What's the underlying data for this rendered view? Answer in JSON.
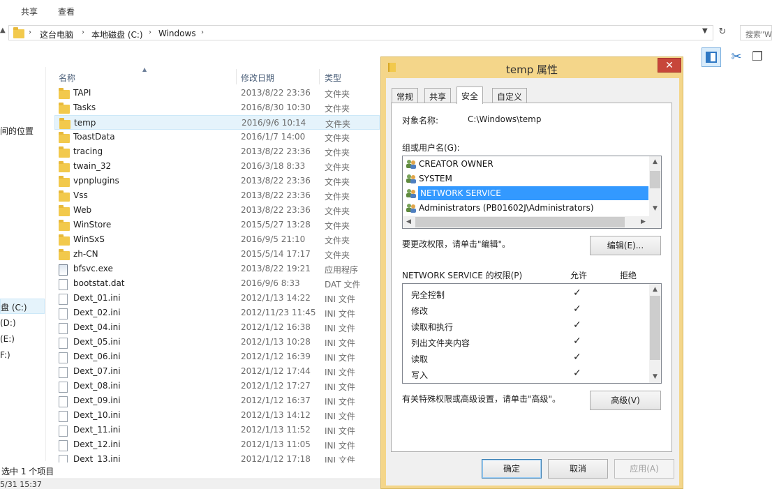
{
  "ribbon": {
    "tabs": [
      "共享",
      "查看"
    ]
  },
  "address": {
    "crumbs": [
      "这台电脑",
      "本地磁盘 (C:)",
      "Windows"
    ],
    "search_placeholder": "搜索\"W"
  },
  "nav": {
    "items": [
      "间的位置",
      "盘 (C:)",
      "(D:)",
      "(E:)",
      "F:)"
    ]
  },
  "file_list": {
    "columns": [
      "名称",
      "修改日期",
      "类型"
    ],
    "rows": [
      {
        "name": "TAPI",
        "date": "2013/8/22 23:36",
        "type": "文件夹",
        "kind": "folder"
      },
      {
        "name": "Tasks",
        "date": "2016/8/30 10:30",
        "type": "文件夹",
        "kind": "folder"
      },
      {
        "name": "temp",
        "date": "2016/9/6 10:14",
        "type": "文件夹",
        "kind": "folder",
        "selected": true
      },
      {
        "name": "ToastData",
        "date": "2016/1/7 14:00",
        "type": "文件夹",
        "kind": "folder"
      },
      {
        "name": "tracing",
        "date": "2013/8/22 23:36",
        "type": "文件夹",
        "kind": "folder"
      },
      {
        "name": "twain_32",
        "date": "2016/3/18 8:33",
        "type": "文件夹",
        "kind": "folder"
      },
      {
        "name": "vpnplugins",
        "date": "2013/8/22 23:36",
        "type": "文件夹",
        "kind": "folder"
      },
      {
        "name": "Vss",
        "date": "2013/8/22 23:36",
        "type": "文件夹",
        "kind": "folder"
      },
      {
        "name": "Web",
        "date": "2013/8/22 23:36",
        "type": "文件夹",
        "kind": "folder"
      },
      {
        "name": "WinStore",
        "date": "2015/5/27 13:28",
        "type": "文件夹",
        "kind": "folder"
      },
      {
        "name": "WinSxS",
        "date": "2016/9/5 21:10",
        "type": "文件夹",
        "kind": "folder"
      },
      {
        "name": "zh-CN",
        "date": "2015/5/14 17:17",
        "type": "文件夹",
        "kind": "folder"
      },
      {
        "name": "bfsvc.exe",
        "date": "2013/8/22 19:21",
        "type": "应用程序",
        "kind": "exe"
      },
      {
        "name": "bootstat.dat",
        "date": "2016/9/6 8:33",
        "type": "DAT 文件",
        "kind": "file"
      },
      {
        "name": "Dext_01.ini",
        "date": "2012/1/13 14:22",
        "type": "INI 文件",
        "kind": "file"
      },
      {
        "name": "Dext_02.ini",
        "date": "2012/11/23 11:45",
        "type": "INI 文件",
        "kind": "file"
      },
      {
        "name": "Dext_04.ini",
        "date": "2012/1/12 16:38",
        "type": "INI 文件",
        "kind": "file"
      },
      {
        "name": "Dext_05.ini",
        "date": "2012/1/13 10:28",
        "type": "INI 文件",
        "kind": "file"
      },
      {
        "name": "Dext_06.ini",
        "date": "2012/1/12 16:39",
        "type": "INI 文件",
        "kind": "file"
      },
      {
        "name": "Dext_07.ini",
        "date": "2012/1/12 17:44",
        "type": "INI 文件",
        "kind": "file"
      },
      {
        "name": "Dext_08.ini",
        "date": "2012/1/12 17:27",
        "type": "INI 文件",
        "kind": "file"
      },
      {
        "name": "Dext_09.ini",
        "date": "2012/1/12 16:37",
        "type": "INI 文件",
        "kind": "file"
      },
      {
        "name": "Dext_10.ini",
        "date": "2012/1/13 14:12",
        "type": "INI 文件",
        "kind": "file"
      },
      {
        "name": "Dext_11.ini",
        "date": "2012/1/13 11:52",
        "type": "INI 文件",
        "kind": "file"
      },
      {
        "name": "Dext_12.ini",
        "date": "2012/1/13 11:05",
        "type": "INI 文件",
        "kind": "file"
      },
      {
        "name": "Dext_13.ini",
        "date": "2012/1/12 17:18",
        "type": "INI 文件",
        "kind": "file"
      }
    ]
  },
  "status": {
    "selection": "选中 1 个项目",
    "bottom_text": "5/31 15:37"
  },
  "dialog": {
    "title": "temp 属性",
    "close_glyph": "✕",
    "tabs": [
      "常规",
      "共享",
      "安全",
      "自定义"
    ],
    "active_tab": "安全",
    "object_label": "对象名称:",
    "object_value": "C:\\Windows\\temp",
    "group_label": "组或用户名(G):",
    "users": [
      "CREATOR OWNER",
      "SYSTEM",
      "NETWORK SERVICE",
      "Administrators (PB01602J\\Administrators)"
    ],
    "selected_user": "NETWORK SERVICE",
    "edit_hint": "要更改权限，请单击\"编辑\"。",
    "edit_button": "编辑(E)...",
    "perm_title": "NETWORK SERVICE 的权限(P)",
    "allow_label": "允许",
    "deny_label": "拒绝",
    "permissions": [
      {
        "name": "完全控制",
        "allow": "✓"
      },
      {
        "name": "修改",
        "allow": "✓"
      },
      {
        "name": "读取和执行",
        "allow": "✓"
      },
      {
        "name": "列出文件夹内容",
        "allow": "✓"
      },
      {
        "name": "读取",
        "allow": "✓"
      },
      {
        "name": "写入",
        "allow": "✓"
      }
    ],
    "advanced_hint": "有关特殊权限或高级设置，请单击\"高级\"。",
    "advanced_button": "高级(V)",
    "ok_button": "确定",
    "cancel_button": "取消",
    "apply_button": "应用(A)"
  },
  "colors": {
    "dialog_frame": "#f4d68a",
    "selection": "#3399ff",
    "close": "#c7463a"
  }
}
